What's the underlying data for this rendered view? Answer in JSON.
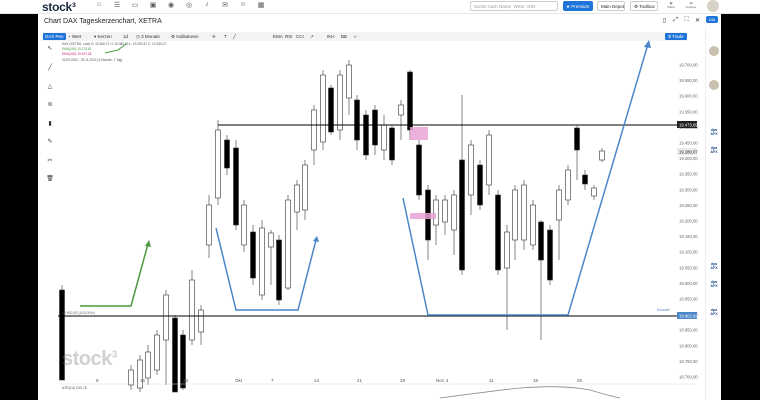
{
  "app": {
    "logo": "stock³",
    "nav_icons": [
      {
        "name": "home-icon",
        "glyph": "⌂"
      },
      {
        "name": "pages-icon",
        "glyph": "☰"
      },
      {
        "name": "monitor-icon",
        "glyph": "▭"
      },
      {
        "name": "tv-icon",
        "glyph": "▣"
      },
      {
        "name": "eye-icon",
        "glyph": "◉"
      },
      {
        "name": "compass-icon",
        "glyph": "◎"
      },
      {
        "name": "bell-icon",
        "glyph": "♪"
      },
      {
        "name": "mail-icon",
        "glyph": "✉"
      },
      {
        "name": "users-icon",
        "glyph": "☺"
      },
      {
        "name": "grid-icon",
        "glyph": "▦"
      }
    ],
    "search_placeholder": "Suche nach Name, WKN, ISIN",
    "premium_label": "★ Premium",
    "depot_label": "Main Depot",
    "toolbox_label": "⚙ Toolbox",
    "top_right_icons": [
      {
        "name": "markets-icon",
        "label": "Markt"
      },
      {
        "name": "chart-icon",
        "label": "Analyse"
      }
    ]
  },
  "chart_header": {
    "title": "Chart DAX Tageskerzenchart, XETRA",
    "badge": "246",
    "panel_icons": [
      {
        "name": "layout-icon",
        "glyph": "▯"
      },
      {
        "name": "expand-icon",
        "glyph": "⤢"
      },
      {
        "name": "fullscreen-icon",
        "glyph": "⛶"
      },
      {
        "name": "close-icon",
        "glyph": "✕"
      }
    ]
  },
  "toolbar": {
    "items": [
      {
        "name": "tab-dax",
        "label": "DAX Pen"
      },
      {
        "name": "tb-wert",
        "label": "+ Wert"
      },
      {
        "name": "tb-kerzen",
        "label": "▾ Kerzen"
      },
      {
        "name": "tb-interval",
        "label": "1d"
      },
      {
        "name": "tb-range",
        "label": "◷ 3 Monate"
      },
      {
        "name": "tb-indikatoren",
        "label": "⚙ Indikatoren"
      },
      {
        "name": "tb-crosshair",
        "label": "✛"
      },
      {
        "name": "tb-text",
        "label": "T"
      },
      {
        "name": "tb-line",
        "label": "╱"
      },
      {
        "name": "tb-ema",
        "label": "EMA"
      },
      {
        "name": "tb-rsi",
        "label": "RSI"
      },
      {
        "name": "tb-cci",
        "label": "CCI"
      },
      {
        "name": "tb-arrow",
        "label": "↗"
      },
      {
        "name": "tb-ikh",
        "label": "IKH"
      },
      {
        "name": "tb-bb",
        "label": "BB"
      },
      {
        "name": "tb-more",
        "label": "»"
      }
    ],
    "trade_label": "$ Trade"
  },
  "legend": {
    "line1": "DAX (XETRA, Last) O: 19.366,72 H: 19.380,69 L: 19.253,47 C: 19.280,07",
    "line2": "EMA(200) 19.173,61",
    "line3": "SMA(200) 19.497,28",
    "line4": "20.09.2024 - 29.11.2024 (3 Monate, 1 Tag)"
  },
  "left_tools": [
    {
      "name": "cursor-icon",
      "glyph": "↖"
    },
    {
      "name": "trend-line-icon",
      "glyph": "╱"
    },
    {
      "name": "triangle-icon",
      "glyph": "△"
    },
    {
      "name": "fib-icon",
      "glyph": "≋"
    },
    {
      "name": "delete-icon",
      "glyph": "▮"
    },
    {
      "name": "brush-icon",
      "glyph": "✎"
    },
    {
      "name": "measure-icon",
      "glyph": "✂"
    },
    {
      "name": "trash-icon",
      "glyph": "🗑"
    }
  ],
  "price_axis": {
    "ticks": [
      "19.700,00",
      "19.650,00",
      "19.600,00",
      "19.550,00",
      "19.500,00",
      "19.450,00",
      "19.400,00",
      "19.350,00",
      "19.300,00",
      "19.250,00",
      "19.200,00",
      "19.150,00",
      "19.100,00",
      "19.050,00",
      "19.000,00",
      "18.950,00",
      "18.900,00",
      "18.850,00",
      "18.800,00",
      "18.750,00",
      "18.700,00"
    ],
    "resistance_label": "19.473,69",
    "last_price_label": "19.280,07",
    "support_label": "18.902,82",
    "support_tag": "Kursziel",
    "left_support_label": "18.902,82 (100,00%)"
  },
  "date_axis": {
    "labels": [
      "9",
      "16",
      "23",
      "Okt",
      "7",
      "14",
      "21",
      "28",
      "Nov",
      "4",
      "11",
      "18",
      "25"
    ]
  },
  "indicator": {
    "label": "ATR(14) 240,75"
  },
  "watermark": "stock",
  "right_sidebar": {
    "items": [
      {
        "name": "news-dpa-1",
        "label": "dpa AFX"
      },
      {
        "name": "news-dpa-2",
        "label": "dpa AFX"
      },
      {
        "name": "news-dpa-3",
        "label": "dpa AFX"
      },
      {
        "name": "news-dpa-4",
        "label": "dpa AFX"
      },
      {
        "name": "news-dpa-5",
        "label": "dpa AFX"
      }
    ]
  },
  "colors": {
    "up_candle": "#ffffff",
    "down_candle": "#000000",
    "annotation_blue": "#4a86c8",
    "annotation_green": "#4c9a3e",
    "highlight_pink": "#e9a3d4",
    "brand_blue": "#1e74d8"
  }
}
